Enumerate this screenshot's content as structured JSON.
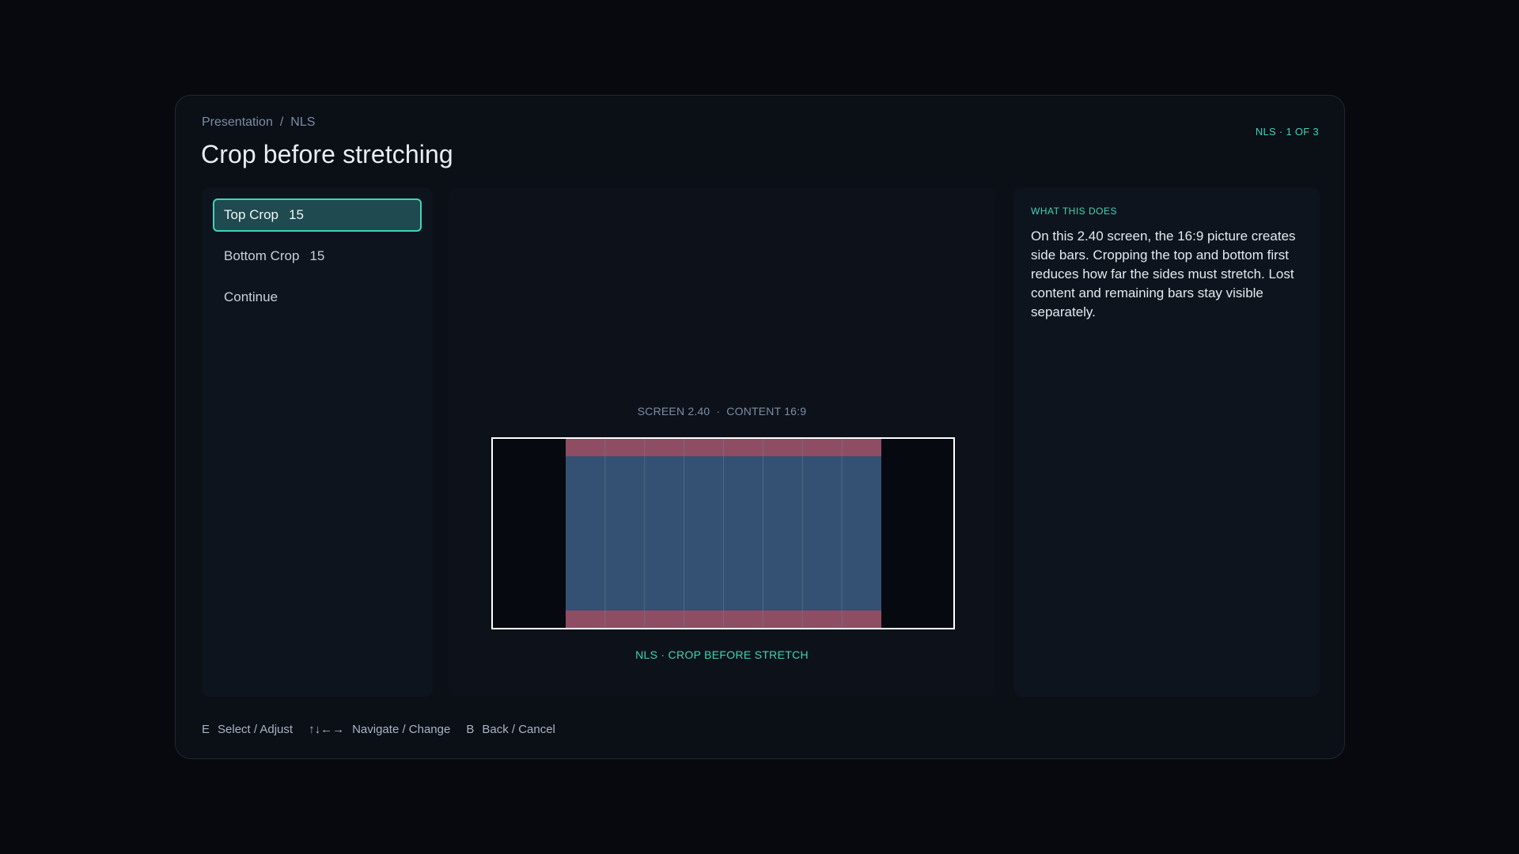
{
  "breadcrumb": {
    "parent": "Presentation",
    "separator": "/",
    "current": "NLS"
  },
  "title": "Crop before stretching",
  "page_counter": "NLS · 1 OF 3",
  "menu": {
    "items": [
      {
        "label": "Top Crop",
        "value": "15",
        "selected": true
      },
      {
        "label": "Bottom Crop",
        "value": "15",
        "selected": false
      },
      {
        "label": "Continue",
        "value": "",
        "selected": false
      }
    ]
  },
  "preview": {
    "screen_label": "SCREEN 2.40",
    "separator": "·",
    "content_label": "CONTENT 16:9",
    "caption": "NLS · CROP BEFORE STRETCH",
    "screen_aspect": 2.4,
    "content_aspect": 1.7778,
    "top_crop": 15,
    "bottom_crop": 15,
    "colors": {
      "content": "#345072",
      "cropped": "#8f4d63",
      "bars": "#060910",
      "frame": "#ffffff",
      "grid": "#6a7d98"
    }
  },
  "info": {
    "heading": "WHAT THIS DOES",
    "body": "On this 2.40 screen, the 16:9 picture creates side bars. Cropping the top and bottom first reduces how far the sides must stretch. Lost content and remaining bars stay visible separately."
  },
  "footer": {
    "hints": [
      {
        "key": "E",
        "label": "Select / Adjust"
      },
      {
        "key": "↑↓←→",
        "label": "Navigate / Change"
      },
      {
        "key": "B",
        "label": "Back / Cancel"
      }
    ]
  },
  "colors": {
    "accent": "#40d3b8",
    "background": "#07090e",
    "panel": "#0e141d"
  }
}
